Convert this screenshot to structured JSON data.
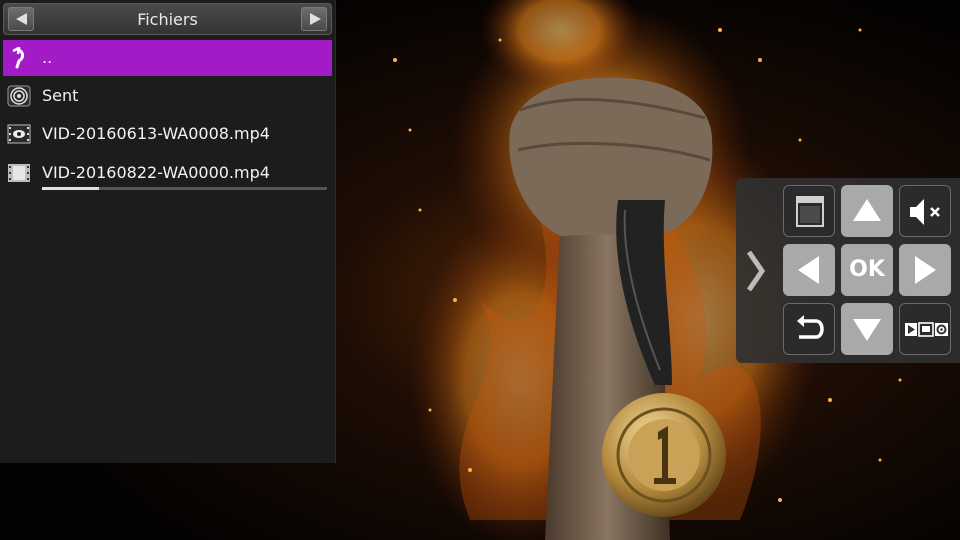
{
  "file_panel": {
    "title": "Fichiers",
    "items": [
      {
        "label": "..",
        "icon": "parent-folder-icon",
        "selected": true
      },
      {
        "label": "Sent",
        "icon": "folder-icon",
        "selected": false
      },
      {
        "label": "VID-20160613-WA0008.mp4",
        "icon": "watched-video-icon",
        "selected": false
      },
      {
        "label": "VID-20160822-WA0000.mp4",
        "icon": "video-file-icon",
        "selected": false,
        "progress": 0.2
      }
    ]
  },
  "remote": {
    "ok_label": "OK",
    "buttons": [
      "window-toggle-icon",
      "arrow-up-icon",
      "mute-icon",
      "arrow-left-icon",
      "ok-button",
      "arrow-right-icon",
      "back-icon",
      "arrow-down-icon",
      "player-settings-icon"
    ]
  },
  "colors": {
    "selection": "#a21bc6",
    "panel_background": "#1c1c1c",
    "remote_button": "#a9a9a9"
  }
}
